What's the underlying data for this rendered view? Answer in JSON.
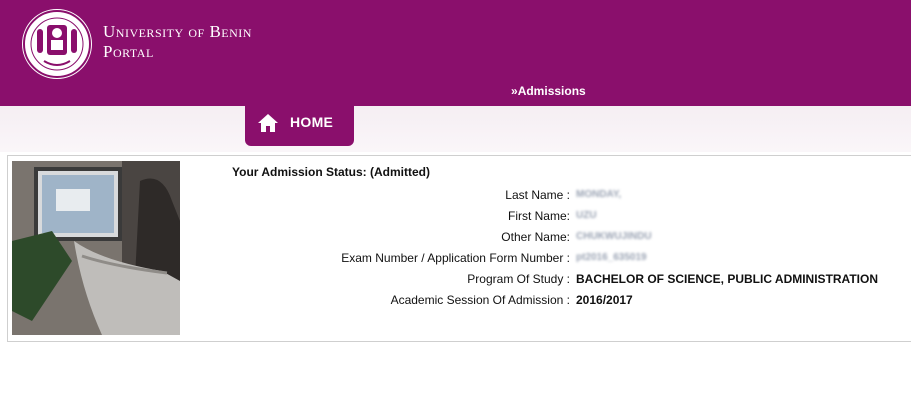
{
  "header": {
    "title_line1": "University of Benin",
    "title_line2": "Portal",
    "nav_link": "Admissions",
    "nav_prefix": "»"
  },
  "tab": {
    "home_label": "HOME"
  },
  "admission": {
    "status": "Your Admission Status: (Admitted)",
    "fields": [
      {
        "label": "Last Name :",
        "value": "MONDAY,"
      },
      {
        "label": "First Name:",
        "value": "UZU"
      },
      {
        "label": "Other Name:",
        "value": "CHUKWUJINDU"
      },
      {
        "label": "Exam Number / Application Form Number :",
        "value": "pt2016_635019"
      },
      {
        "label": "Program Of Study :",
        "value": "BACHELOR OF SCIENCE, PUBLIC ADMINISTRATION"
      },
      {
        "label": "Academic Session Of Admission :",
        "value": "2016/2017"
      }
    ]
  },
  "colors": {
    "brand": "#8a0f6c",
    "band": "#f5eef3",
    "blurred_text": "#9aa3b3"
  },
  "icons": {
    "logo": "university-crest-logo",
    "home": "home-icon"
  }
}
